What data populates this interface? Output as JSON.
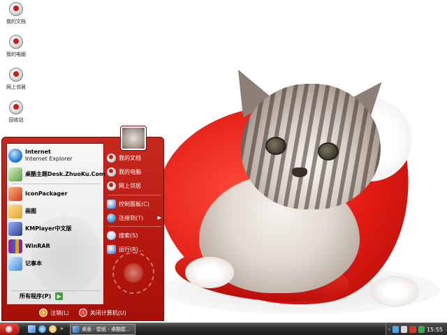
{
  "desktop": {
    "icons": [
      {
        "label": "我的文档",
        "icon": "my-documents-icon"
      },
      {
        "label": "我的电脑",
        "icon": "my-computer-icon"
      },
      {
        "label": "网上邻居",
        "icon": "network-places-icon"
      },
      {
        "label": "回收站",
        "icon": "recycle-bin-icon"
      }
    ]
  },
  "start_menu": {
    "pinned": [
      {
        "title": "Internet",
        "subtitle": "Internet Explorer",
        "icon": "internet-explorer-icon",
        "color": "#1e78d7"
      }
    ],
    "programs": [
      {
        "label": "桌酷主题Desk.ZhuoKu.Com",
        "icon": "zhuoku-theme-icon",
        "color": "#5aa040"
      },
      {
        "label": "IconPackager",
        "icon": "iconpackager-icon",
        "color": "#d23a1c"
      },
      {
        "label": "画图",
        "icon": "paint-icon",
        "color": "#e0a230"
      },
      {
        "label": "KMPlayer中文版",
        "icon": "kmplayer-icon",
        "color": "#2a3f8e"
      },
      {
        "label": "WinRAR",
        "icon": "winrar-icon",
        "color": "#8a2a9a"
      },
      {
        "label": "记事本",
        "icon": "notepad-icon",
        "color": "#3a8ad8"
      }
    ],
    "all_programs": "所有程序(P)",
    "places": [
      {
        "label": "我的文档",
        "icon": "my-documents-icon"
      },
      {
        "label": "我的电脑",
        "icon": "my-computer-icon"
      },
      {
        "label": "网上邻居",
        "icon": "network-places-icon"
      },
      {
        "label": "控制面板(C)",
        "icon": "control-panel-icon"
      },
      {
        "label": "连接到(T)",
        "icon": "connect-to-icon",
        "submenu": true
      },
      {
        "label": "搜索(S)",
        "icon": "search-icon"
      },
      {
        "label": "运行(R)...",
        "icon": "run-icon"
      }
    ],
    "logoff": "注销(L)",
    "shutdown": "关闭计算机(U)"
  },
  "taskbar": {
    "quick_launch": [
      {
        "icon": "show-desktop-icon",
        "color": "#4a8ad8"
      },
      {
        "icon": "internet-explorer-icon",
        "color": "#1e78d7"
      },
      {
        "icon": "media-player-icon",
        "color": "#e6a02a"
      }
    ],
    "quick_launch_more": "»",
    "task_label": "桌面 - 壁纸 - 桌酷壁...",
    "tray_more": "‹",
    "tray_icons": [
      {
        "icon": "network-tray-icon",
        "color": "#5aa0e8"
      },
      {
        "icon": "volume-tray-icon",
        "color": "#d8d8d8"
      },
      {
        "icon": "security-tray-icon",
        "color": "#d03a2a"
      },
      {
        "icon": "im-tray-icon",
        "color": "#3aa85a"
      }
    ],
    "clock": "15:55"
  }
}
